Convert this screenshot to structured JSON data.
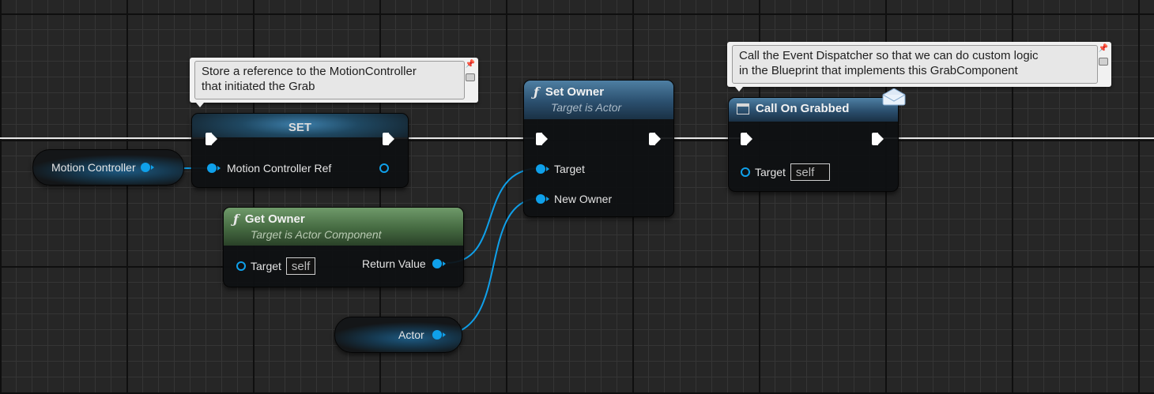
{
  "comments": {
    "store_ref": {
      "line1": "Store a reference to the MotionController",
      "line2": "that initiated the Grab"
    },
    "call_dispatcher": {
      "line1": "Call the Event Dispatcher so that we can do custom logic",
      "line2": "in the Blueprint that implements this GrabComponent"
    }
  },
  "nodes": {
    "set": {
      "title": "SET",
      "input_label": "Motion Controller Ref"
    },
    "motion_controller": {
      "label": "Motion Controller"
    },
    "get_owner": {
      "title": "Get Owner",
      "subtitle": "Target is Actor Component",
      "target_label": "Target",
      "target_value": "self",
      "return_label": "Return Value"
    },
    "actor": {
      "label": "Actor"
    },
    "set_owner": {
      "title": "Set Owner",
      "subtitle": "Target is Actor",
      "target_label": "Target",
      "new_owner_label": "New Owner"
    },
    "call_on_grabbed": {
      "title": "Call On Grabbed",
      "target_label": "Target",
      "target_value": "self"
    }
  },
  "icons": {
    "function": "ƒ",
    "event_dispatcher": "envelope-icon",
    "comment_pin": "pushpin-icon",
    "comment_bubble": "comment-bubble-icon"
  },
  "colors": {
    "exec_wire": "#ffffff",
    "object_pin": "#0fa0ea",
    "function_header": "#2b4f6e",
    "pure_function_header": "#456a41",
    "comment_bg": "#f1f1f1"
  }
}
